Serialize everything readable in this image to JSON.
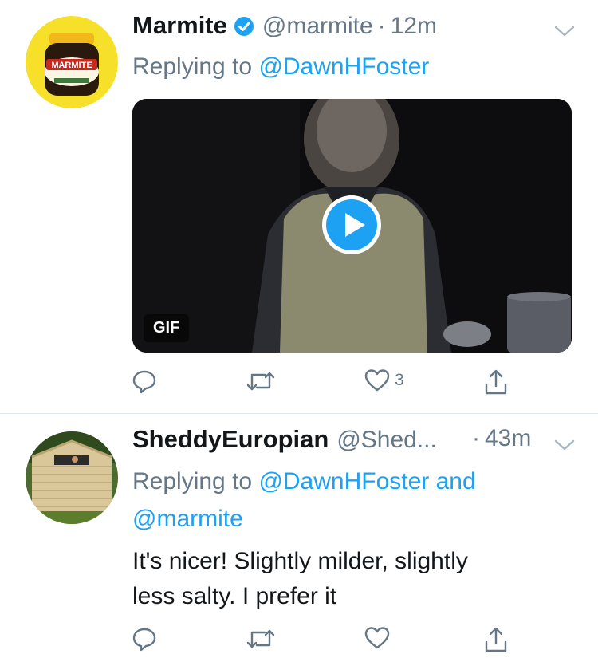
{
  "tweets": [
    {
      "name": "Marmite",
      "handle": "@marmite",
      "sep": "·",
      "time": "12m",
      "reply_prefix": "Replying to",
      "reply_users": "@DawnHFoster",
      "reply_line2": "",
      "media_badge": "GIF",
      "like_count": "3",
      "avatar_text": "MARMITE"
    },
    {
      "name": "SheddyEuropian",
      "handle": "@Shed...",
      "sep": "·",
      "time": "43m",
      "reply_prefix": "Replying to",
      "reply_users": "@DawnHFoster and",
      "reply_line2": "@marmite",
      "text_line1": "It's nicer! Slightly milder, slightly",
      "text_line2": "less salty. I prefer it"
    }
  ],
  "colors": {
    "link": "#1da1f2",
    "muted": "#657786",
    "text": "#14171a",
    "verified": "#1da1f2",
    "divider": "#e1e8ed"
  },
  "icons": [
    "verified-badge-icon",
    "chevron-down-icon",
    "reply-icon",
    "retweet-icon",
    "like-icon",
    "share-icon",
    "play-icon"
  ]
}
